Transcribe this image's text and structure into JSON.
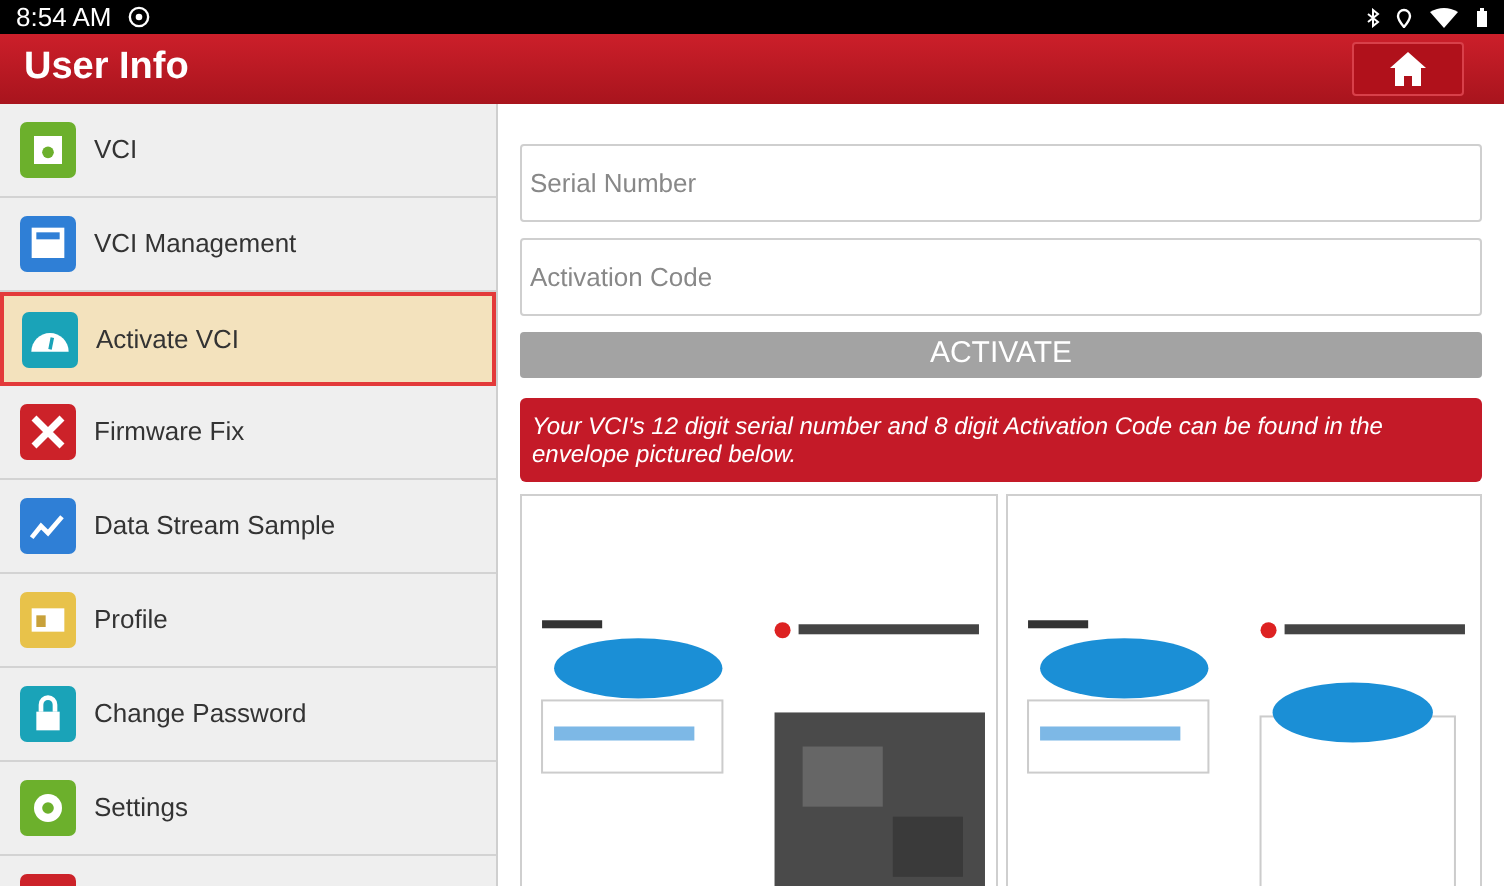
{
  "status_bar": {
    "time": "8:54 AM"
  },
  "header": {
    "title": "User Info"
  },
  "sidebar": {
    "items": [
      {
        "label": "VCI",
        "color": "#6cb02c",
        "selected": false
      },
      {
        "label": "VCI Management",
        "color": "#2f7fd6",
        "selected": false
      },
      {
        "label": "Activate VCI",
        "color": "#1aa3b8",
        "selected": true
      },
      {
        "label": "Firmware Fix",
        "color": "#cc2229",
        "selected": false
      },
      {
        "label": "Data Stream Sample",
        "color": "#2f7fd6",
        "selected": false
      },
      {
        "label": "Profile",
        "color": "#e8c24a",
        "selected": false
      },
      {
        "label": "Change Password",
        "color": "#1aa3b8",
        "selected": false
      },
      {
        "label": "Settings",
        "color": "#6cb02c",
        "selected": false
      },
      {
        "color": "#cc2229",
        "selected": false
      }
    ]
  },
  "form": {
    "serial": {
      "placeholder": "Serial Number"
    },
    "code": {
      "placeholder": "Activation Code"
    },
    "button": {
      "label": "ACTIVATE",
      "disabled": true
    },
    "notice": "Your VCI's 12 digit serial number and 8 digit Activation Code can be found in the envelope pictured below."
  }
}
